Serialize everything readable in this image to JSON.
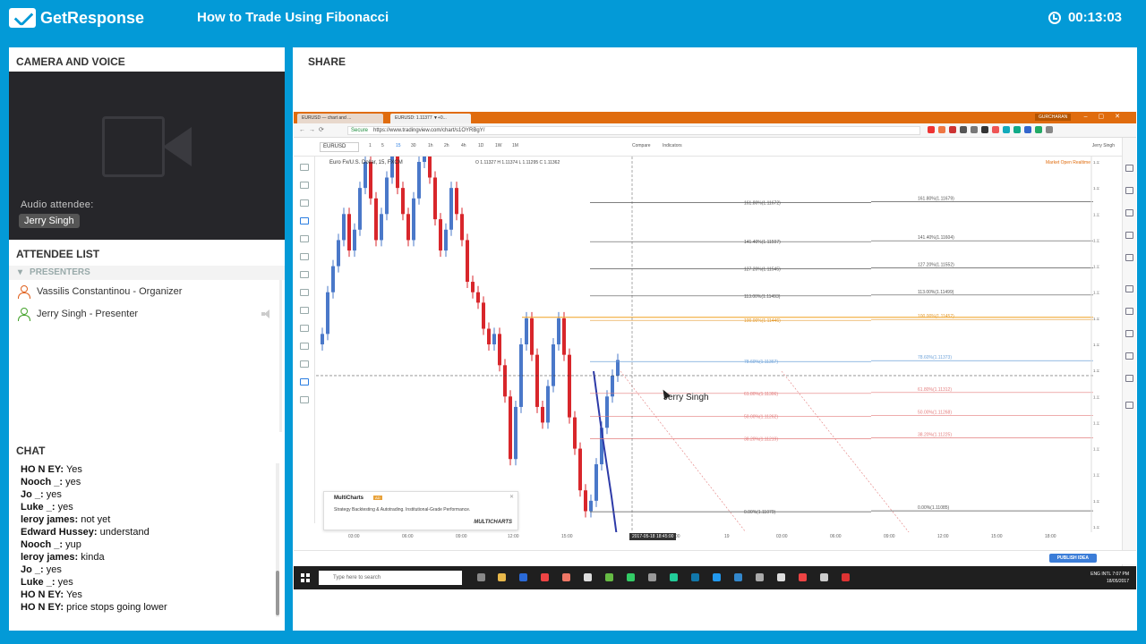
{
  "app": {
    "brand": "GetResponse",
    "webinar_title": "How to Trade Using Fibonacci",
    "timer": "00:13:03"
  },
  "camera": {
    "title": "CAMERA AND VOICE",
    "audio_label": "Audio attendee:",
    "audio_name": "Jerry Singh"
  },
  "attendees": {
    "title": "ATTENDEE LIST",
    "group_label": "PRESENTERS",
    "items": [
      {
        "label": "Vassilis Constantinou - Organizer",
        "color": "#e0601d"
      },
      {
        "label": "Jerry Singh - Presenter",
        "color": "#43a22a"
      }
    ]
  },
  "chat": {
    "title": "CHAT",
    "messages": [
      {
        "user": "HO N EY:",
        "text": "Yes"
      },
      {
        "user": "Nooch _:",
        "text": "yes"
      },
      {
        "user": "Jo _:",
        "text": "yes"
      },
      {
        "user": "Luke _:",
        "text": "yes"
      },
      {
        "user": "leroy james:",
        "text": "not yet"
      },
      {
        "user": "Edward Hussey:",
        "text": "understand"
      },
      {
        "user": "Nooch _:",
        "text": "yup"
      },
      {
        "user": "leroy james:",
        "text": "kinda"
      },
      {
        "user": "Jo _:",
        "text": "yes"
      },
      {
        "user": "Luke _:",
        "text": "yes"
      },
      {
        "user": "HO N EY:",
        "text": "Yes"
      },
      {
        "user": "HO N EY:",
        "text": "price stops going lower"
      }
    ]
  },
  "share": {
    "title": "SHARE",
    "browser": {
      "tab1": "EURUSD — chart and ...",
      "tab2": "EURUSD: 1.11377 ▼+0...",
      "user_badge": "GURCHARAN",
      "secure_label": "Secure",
      "url": "https://www.tradingview.com/chart/s1OYRBgY/"
    },
    "tradingview": {
      "symbol": "EURUSD",
      "timeframes": [
        "1",
        "5",
        "15",
        "30",
        "1h",
        "2h",
        "4h",
        "1D",
        "1W",
        "1M"
      ],
      "compare_label": "Compare",
      "indicators_label": "Indicators",
      "user_label": "Jerry Singh",
      "chart_title": "Euro Fx/U.S. Dollar, 15, FXCM",
      "ohlc": "O 1.11327  H 1.11374  L 1.11295  C 1.11362",
      "market_status": "Market Open  Realtime",
      "cursor_label": "Jerry Singh",
      "time_labels": [
        "03:00",
        "06:00",
        "09:00",
        "12:00",
        "15:00",
        "21:00",
        "19",
        "03:00",
        "06:00",
        "09:00",
        "12:00",
        "15:00",
        "18:00"
      ],
      "crosshair_date": "2017-05-18 18:45:00",
      "publish_label": "PUBLISH IDEA",
      "fib_left": [
        "161.80%(1.11672)",
        "141.40%(1.11597)",
        "127.20%(1.11545)",
        "113.00%(1.11493)",
        "100.00%(1.11446)",
        "78.60%(1.11367)",
        "61.80%(1.11306)",
        "50.00%(1.11262)",
        "38.20%(1.11219)",
        "0.00%(1.11079)"
      ],
      "fib_right": [
        "161.80%(1.11679)",
        "141.40%(1.11604)",
        "127.20%(1.11552)",
        "113.00%(1.11499)",
        "100.00%(1.11452)",
        "78.60%(1.11373)",
        "61.80%(1.11312)",
        "50.00%(1.11268)",
        "38.20%(1.11225)",
        "0.00%(1.11085)"
      ],
      "price_axis": [
        "1.11750",
        "1.11700",
        "1.11650",
        "1.11600",
        "1.11550",
        "1.11500",
        "1.11450",
        "1.11400",
        "1.11350",
        "1.11300",
        "1.11250",
        "1.11200",
        "1.11150",
        "1.11100",
        "1.11050"
      ],
      "ad": {
        "title": "MultiCharts",
        "badge": "AD",
        "text": "Strategy Backtesting & Autotrading. Institutional-Grade Performance.",
        "brand": "MULTICHARTS"
      }
    },
    "taskbar": {
      "search_placeholder": "Type here to search",
      "lang": "ENG INTL",
      "time": "7:07 PM",
      "date": "18/05/2017"
    }
  }
}
